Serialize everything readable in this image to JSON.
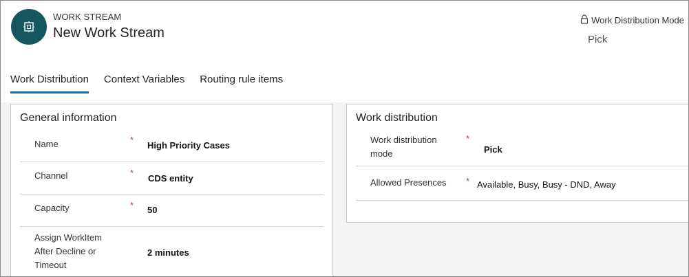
{
  "header": {
    "entity_type": "WORK STREAM",
    "record_title": "New Work Stream",
    "mode_label": "Work Distribution Mode",
    "mode_value": "Pick",
    "avatar_icon": "workstream-icon",
    "lock_icon": "lock-icon"
  },
  "tabs": [
    {
      "label": "Work Distribution",
      "active": true
    },
    {
      "label": "Context Variables",
      "active": false
    },
    {
      "label": "Routing rule items",
      "active": false
    }
  ],
  "general": {
    "title": "General information",
    "fields": [
      {
        "label": "Name",
        "required": "*",
        "value": "High Priority Cases"
      },
      {
        "label": "Channel",
        "required": "*",
        "value": "CDS entity"
      },
      {
        "label": "Capacity",
        "required": "*",
        "value": "50"
      },
      {
        "label_lines": [
          "Assign WorkItem",
          "After Decline or",
          "Timeout"
        ],
        "required": "",
        "value": "2 minutes"
      }
    ]
  },
  "work_distribution": {
    "title": "Work distribution",
    "fields": [
      {
        "label_lines": [
          "Work distribution",
          "mode"
        ],
        "required": "*",
        "value": "Pick"
      },
      {
        "label": "Allowed Presences",
        "required": "*",
        "value": "Available, Busy, Busy - DND, Away"
      }
    ]
  },
  "colors": {
    "accent": "#0f6cbd",
    "avatar_bg": "#16565e",
    "required": "#c0392b"
  }
}
